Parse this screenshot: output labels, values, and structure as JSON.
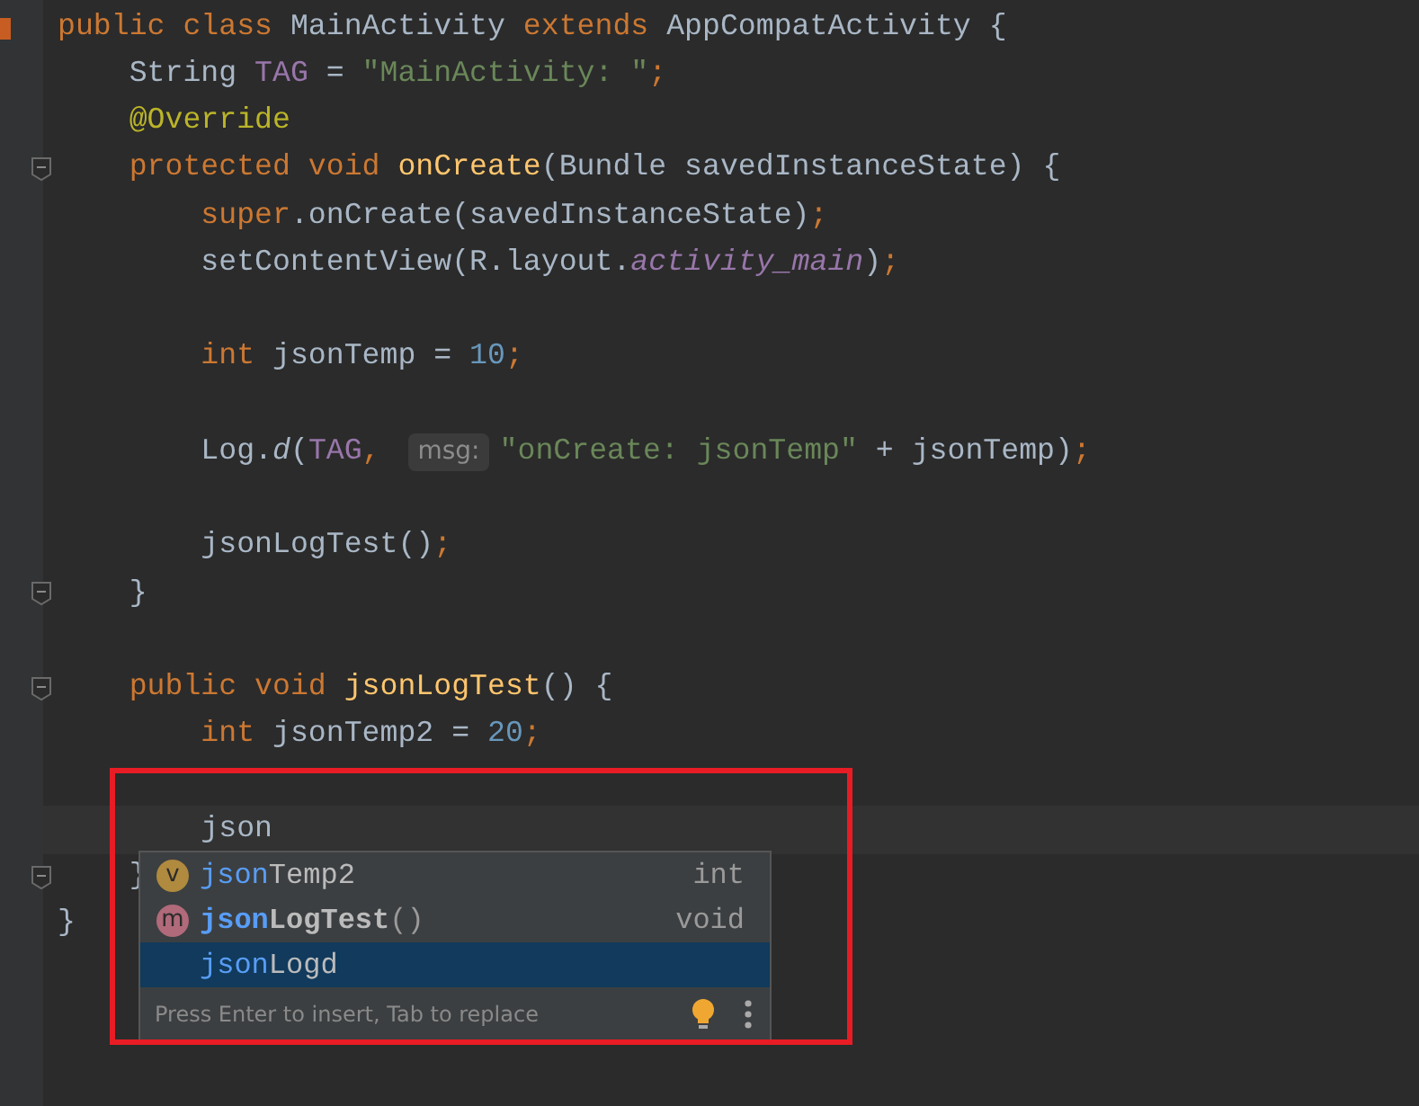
{
  "editor": {
    "lines": [
      {
        "tokens": [
          {
            "t": "public class ",
            "kind": "kw"
          },
          {
            "t": "MainActivity ",
            "kind": "plain"
          },
          {
            "t": "extends ",
            "kind": "kw"
          },
          {
            "t": "AppCompatActivity {",
            "kind": "plain"
          }
        ],
        "changed": true
      },
      {
        "tokens": [
          {
            "t": "    String ",
            "kind": "plain"
          },
          {
            "t": "TAG",
            "kind": "field"
          },
          {
            "t": " = ",
            "kind": "plain"
          },
          {
            "t": "\"MainActivity: \"",
            "kind": "str"
          },
          {
            "t": ";",
            "kind": "kw"
          }
        ]
      },
      {
        "tokens": [
          {
            "t": "    @Override",
            "kind": "anno"
          }
        ]
      },
      {
        "tokens": [
          {
            "t": "    protected void ",
            "kind": "kw"
          },
          {
            "t": "onCreate",
            "kind": "decl"
          },
          {
            "t": "(Bundle savedInstanceState) {",
            "kind": "plain"
          }
        ],
        "fold": true
      },
      {
        "tokens": [
          {
            "t": "        super",
            "kind": "kw"
          },
          {
            "t": ".onCreate(savedInstanceState)",
            "kind": "plain"
          },
          {
            "t": ";",
            "kind": "kw"
          }
        ]
      },
      {
        "tokens": [
          {
            "t": "        setContentView(R.layout.",
            "kind": "plain"
          },
          {
            "t": "activity_main",
            "kind": "sfield"
          },
          {
            "t": ")",
            "kind": "plain"
          },
          {
            "t": ";",
            "kind": "kw"
          }
        ]
      },
      {
        "blank_before": true,
        "tokens": [
          {
            "t": "        int ",
            "kind": "kw"
          },
          {
            "t": "jsonTemp = ",
            "kind": "plain"
          },
          {
            "t": "10",
            "kind": "num"
          },
          {
            "t": ";",
            "kind": "kw"
          }
        ]
      },
      {
        "blank_before": true,
        "tokens": [
          {
            "t": "        Log.",
            "kind": "plain"
          },
          {
            "t": "d",
            "kind": "static"
          },
          {
            "t": "(",
            "kind": "plain"
          },
          {
            "t": "TAG",
            "kind": "field"
          },
          {
            "t": ", ",
            "kind": "kw"
          },
          {
            "t": "msg:",
            "kind": "hint"
          },
          {
            "t": "\"onCreate: jsonTemp\"",
            "kind": "str"
          },
          {
            "t": " + jsonTemp)",
            "kind": "plain"
          },
          {
            "t": ";",
            "kind": "kw"
          }
        ]
      },
      {
        "blank_before": true,
        "tokens": [
          {
            "t": "        jsonLogTest()",
            "kind": "plain"
          },
          {
            "t": ";",
            "kind": "kw"
          }
        ]
      },
      {
        "tokens": [
          {
            "t": "    }",
            "kind": "plain"
          }
        ],
        "fold": true
      },
      {
        "blank_before": true,
        "tokens": [
          {
            "t": "    public void ",
            "kind": "kw"
          },
          {
            "t": "jsonLogTest",
            "kind": "decl"
          },
          {
            "t": "() {",
            "kind": "plain"
          }
        ],
        "fold": true
      },
      {
        "tokens": [
          {
            "t": "        int ",
            "kind": "kw"
          },
          {
            "t": "jsonTemp2 = ",
            "kind": "plain"
          },
          {
            "t": "20",
            "kind": "num"
          },
          {
            "t": ";",
            "kind": "kw"
          }
        ]
      },
      {
        "blank_before": true,
        "tokens": [
          {
            "t": "        json",
            "kind": "plain"
          }
        ],
        "current": true
      },
      {
        "tokens": [
          {
            "t": "    }",
            "kind": "plain"
          }
        ],
        "fold": true
      },
      {
        "tokens": [
          {
            "t": "}",
            "kind": "plain"
          }
        ]
      }
    ]
  },
  "completion": {
    "items": [
      {
        "badge": "v",
        "color": "#b08a3e",
        "match": "json",
        "rest": "Temp2",
        "bold": false,
        "type": "int",
        "selected": false
      },
      {
        "badge": "m",
        "color": "#b06a7a",
        "match": "json",
        "rest": "LogTest",
        "suffix": "()",
        "bold": true,
        "type": "void",
        "selected": false
      },
      {
        "match": "json",
        "rest": "Logd",
        "bold": false,
        "selected": true
      }
    ],
    "footer": "Press Enter to insert, Tab to replace"
  }
}
